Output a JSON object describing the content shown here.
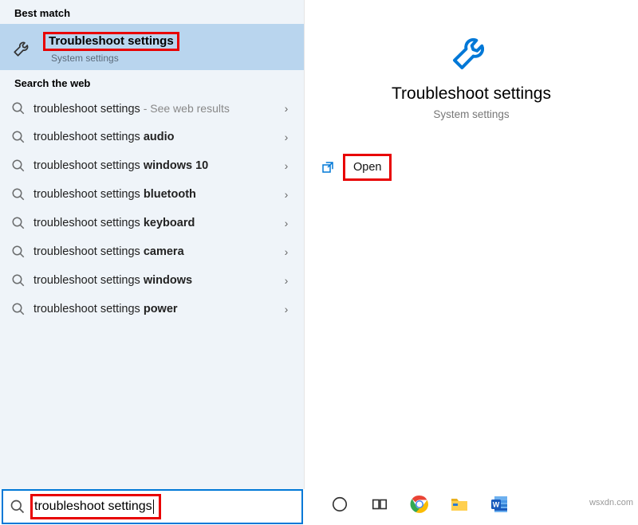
{
  "left": {
    "best_match_header": "Best match",
    "best_match": {
      "title": "Troubleshoot settings",
      "subtitle": "System settings"
    },
    "web_header": "Search the web",
    "web_items": [
      {
        "prefix": "troubleshoot settings",
        "bold": "",
        "suffix": " - See web results"
      },
      {
        "prefix": "troubleshoot settings ",
        "bold": "audio",
        "suffix": ""
      },
      {
        "prefix": "troubleshoot settings ",
        "bold": "windows 10",
        "suffix": ""
      },
      {
        "prefix": "troubleshoot settings ",
        "bold": "bluetooth",
        "suffix": ""
      },
      {
        "prefix": "troubleshoot settings ",
        "bold": "keyboard",
        "suffix": ""
      },
      {
        "prefix": "troubleshoot settings ",
        "bold": "camera",
        "suffix": ""
      },
      {
        "prefix": "troubleshoot settings ",
        "bold": "windows",
        "suffix": ""
      },
      {
        "prefix": "troubleshoot settings ",
        "bold": "power",
        "suffix": ""
      }
    ]
  },
  "right": {
    "title": "Troubleshoot settings",
    "subtitle": "System settings",
    "open": "Open"
  },
  "search": {
    "value": "troubleshoot settings"
  },
  "taskbar": {
    "items": [
      "cortana",
      "task-view",
      "chrome",
      "file-explorer",
      "word"
    ]
  },
  "watermark": "wsxdn.com"
}
